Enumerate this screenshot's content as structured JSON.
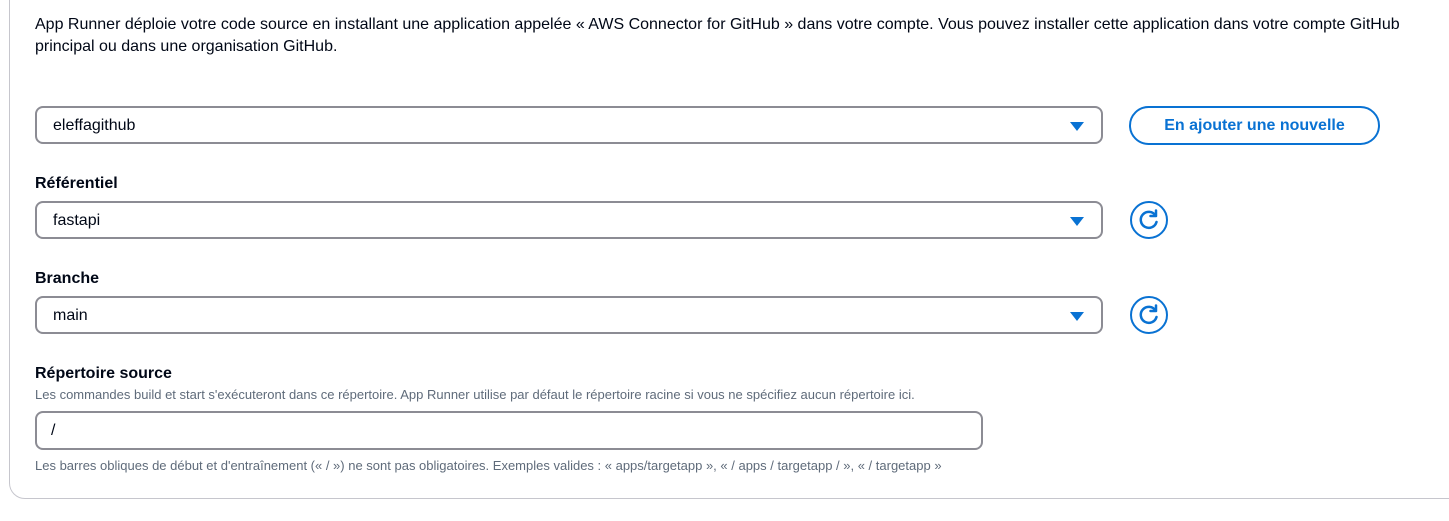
{
  "intro_text": "App Runner déploie votre code source en installant une application appelée « AWS Connector for GitHub » dans votre compte. Vous pouvez installer cette application dans votre compte GitHub principal ou dans une organisation GitHub.",
  "connection": {
    "selected": "eleffagithub",
    "add_button_label": "En ajouter une nouvelle"
  },
  "repository": {
    "label": "Référentiel",
    "selected": "fastapi",
    "refresh_icon": "refresh-icon"
  },
  "branch": {
    "label": "Branche",
    "selected": "main",
    "refresh_icon": "refresh-icon"
  },
  "source_directory": {
    "label": "Répertoire source",
    "description": "Les commandes build et start s'exécuteront dans ce répertoire. App Runner utilise par défaut le répertoire racine si vous ne spécifiez aucun répertoire ici.",
    "value": "/",
    "hint": "Les barres obliques de début et d'entraînement (« / ») ne sont pas obligatoires. Exemples valides : « apps/targetapp », « / apps / targetapp / », « / targetapp »"
  },
  "colors": {
    "accent": "#0972d3",
    "border": "#8c8c94",
    "text": "#000716",
    "secondary_text": "#5f6b7a"
  }
}
